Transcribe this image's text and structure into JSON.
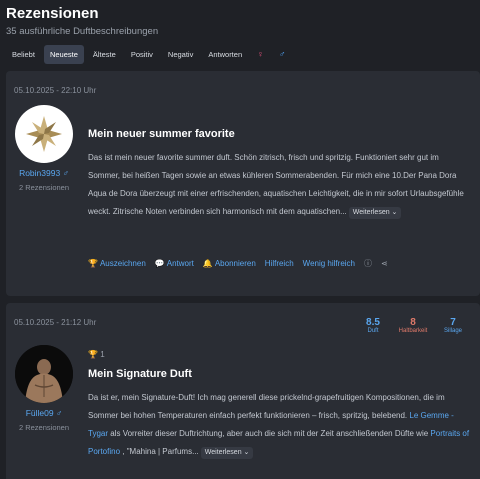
{
  "header": {
    "title": "Rezensionen",
    "subtitle": "35 ausführliche Duftbeschreibungen",
    "tabs": [
      {
        "label": "Beliebt",
        "active": false
      },
      {
        "label": "Neueste",
        "active": true
      },
      {
        "label": "Älteste",
        "active": false
      },
      {
        "label": "Positiv",
        "active": false
      },
      {
        "label": "Negativ",
        "active": false
      },
      {
        "label": "Antworten",
        "active": false
      },
      {
        "label": "♀",
        "active": false
      },
      {
        "label": "♂",
        "active": false
      }
    ]
  },
  "reviews": [
    {
      "date": "05.10.2025 - 22:10 Uhr",
      "username": "Robin3993 ♂",
      "user_count": "2 Rezensionen",
      "title": "Mein neuer summer favorite",
      "body": "Das ist mein neuer favorite summer duft. Schön zitrisch, frisch und spritzig. Funktioniert sehr gut im Sommer, bei heißen Tagen sowie an etwas kühleren Sommerabenden. Für mich eine 10.Der Pana Dora Aqua de Dora überzeugt mit einer erfrischenden, aquatischen Leichtigkeit, die in mir sofort Urlaubsgefühle weckt. Zitrische Noten verbinden sich harmonisch mit dem aquatischen...",
      "more_label": "Weiterlesen ⌄",
      "actions": {
        "award": "Auszeichnen",
        "reply": "Antwort",
        "subscribe": "Abonnieren",
        "helpful": "Hilfreich",
        "less_helpful": "Wenig hilfreich"
      }
    },
    {
      "date": "05.10.2025 - 21:12 Uhr",
      "username": "Fülle09 ♂",
      "user_count": "2 Rezensionen",
      "award_count": "1",
      "title": "Mein Signature Duft",
      "body_1": "Da ist er, mein Signature-Duft! Ich mag generell diese prickelnd-grapefruitigen Kompositionen, die im Sommer bei hohen Temperaturen einfach perfekt funktionieren – frisch, spritzig, belebend. ",
      "link_1": "Le Gemme - Tygar",
      "body_2": " als Vorreiter dieser Duftrichtung, aber auch die sich mit der Zeit anschließenden Düfte wie ",
      "link_2": "Portraits of Portofino",
      "body_3": " , \"Mahina | Parfums...",
      "more_label": "Weiterlesen ⌄",
      "ratings": [
        {
          "value": "8.5",
          "label": "Duft",
          "color": "#5aa7f0"
        },
        {
          "value": "8",
          "label": "Haltbarkeit",
          "color": "#e07a6a"
        },
        {
          "value": "7",
          "label": "Sillage",
          "color": "#5aa7f0"
        }
      ]
    }
  ]
}
